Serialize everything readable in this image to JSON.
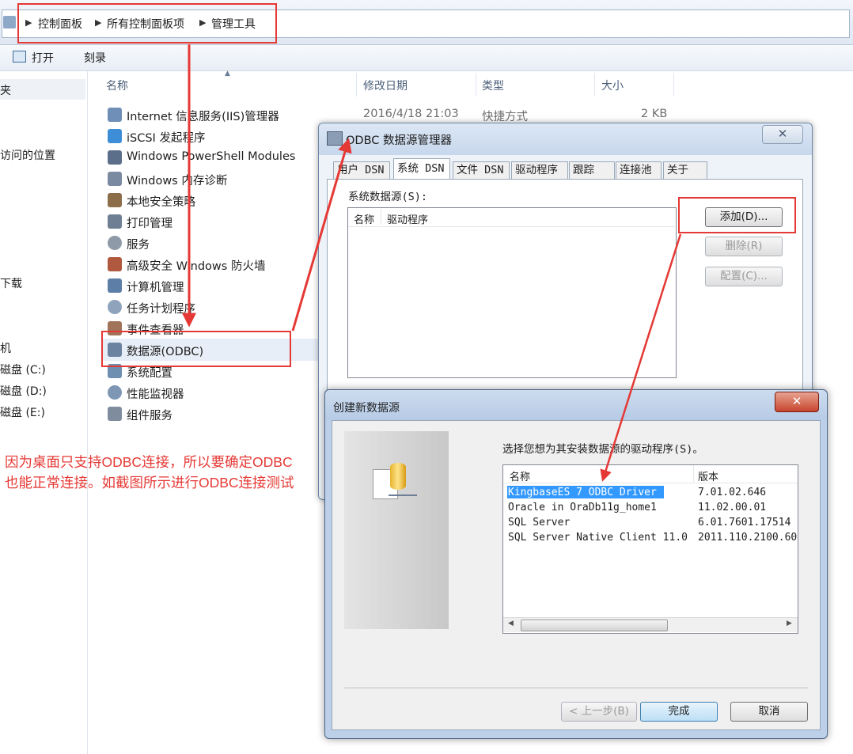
{
  "breadcrumb": [
    "控制面板",
    "所有控制面板项",
    "管理工具"
  ],
  "toolbar": {
    "open": "打开",
    "burn": "刻录"
  },
  "nav": [
    "夹",
    "访问的位置",
    "下载",
    "机",
    "磁盘 (C:)",
    "磁盘 (D:)",
    "磁盘 (E:)"
  ],
  "columns": {
    "name": "名称",
    "modified": "修改日期",
    "type": "类型",
    "size": "大小"
  },
  "files": [
    {
      "name": "Internet 信息服务(IIS)管理器",
      "modified": "2016/4/18 21:03",
      "type": "快捷方式",
      "size": "2 KB"
    },
    {
      "name": "iSCSI 发起程序"
    },
    {
      "name": "Windows PowerShell Modules"
    },
    {
      "name": "Windows 内存诊断"
    },
    {
      "name": "本地安全策略"
    },
    {
      "name": "打印管理"
    },
    {
      "name": "服务"
    },
    {
      "name": "高级安全 Windows 防火墙"
    },
    {
      "name": "计算机管理"
    },
    {
      "name": "任务计划程序"
    },
    {
      "name": "事件查看器"
    },
    {
      "name": "数据源(ODBC)"
    },
    {
      "name": "系统配置"
    },
    {
      "name": "性能监视器"
    },
    {
      "name": "组件服务"
    }
  ],
  "annotation": {
    "line1": "因为桌面只支持ODBC连接，所以要确定ODBC",
    "line2": "也能正常连接。如截图所示进行ODBC连接测试"
  },
  "odbc": {
    "title": "ODBC 数据源管理器",
    "tabs": [
      "用户 DSN",
      "系统 DSN",
      "文件 DSN",
      "驱动程序",
      "跟踪",
      "连接池",
      "关于"
    ],
    "section_label": "系统数据源(S):",
    "list_headers": [
      "名称",
      "驱动程序"
    ],
    "buttons": {
      "add": "添加(D)...",
      "remove": "删除(R)",
      "config": "配置(C)..."
    }
  },
  "create": {
    "title": "创建新数据源",
    "prompt": "选择您想为其安装数据源的驱动程序(S)。",
    "headers": [
      "名称",
      "版本"
    ],
    "drivers": [
      {
        "name": "KingbaseES 7 ODBC Driver",
        "version": "7.01.02.646"
      },
      {
        "name": "Oracle in OraDb11g_home1",
        "version": "11.02.00.01"
      },
      {
        "name": "SQL Server",
        "version": "6.01.7601.17514"
      },
      {
        "name": "SQL Server Native Client 11.0",
        "version": "2011.110.2100.60"
      }
    ],
    "buttons": {
      "back": "< 上一步(B)",
      "finish": "完成",
      "cancel": "取消"
    }
  },
  "colors": {
    "annotation_red": "#e53935",
    "selection_blue": "#3399ff"
  }
}
